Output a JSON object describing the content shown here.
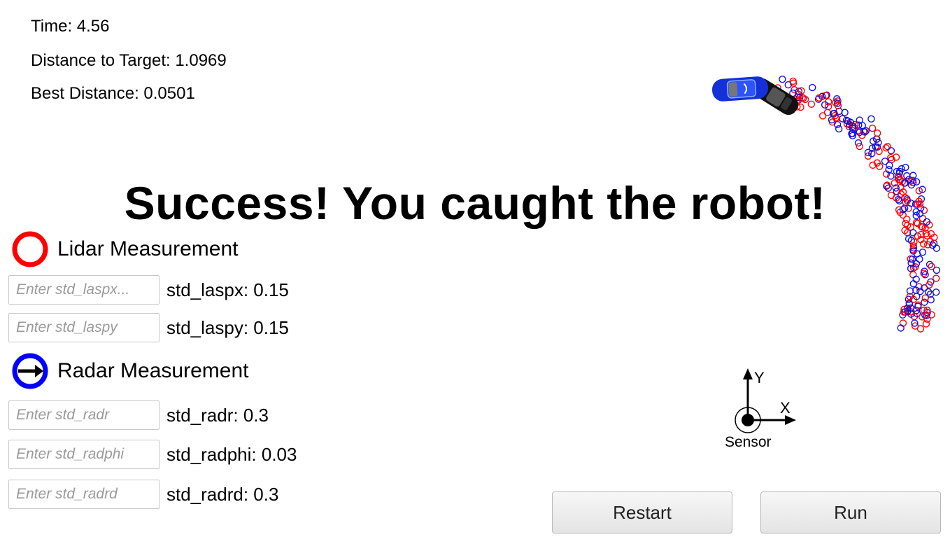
{
  "stats": {
    "time": "Time: 4.56",
    "distance": "Distance to Target: 1.0969",
    "best": "Best Distance: 0.0501"
  },
  "headline": "Success! You caught the robot!",
  "lidar": {
    "title": "Lidar Measurement",
    "color": "#ff0000",
    "fields": [
      {
        "placeholder": "Enter std_laspx...",
        "value_text": "std_laspx: 0.15"
      },
      {
        "placeholder": "Enter std_laspy",
        "value_text": "std_laspy: 0.15"
      }
    ]
  },
  "radar": {
    "title": "Radar Measurement",
    "color": "#0000ff",
    "fields": [
      {
        "placeholder": "Enter std_radr",
        "value_text": "std_radr: 0.3"
      },
      {
        "placeholder": "Enter std_radphi",
        "value_text": "std_radphi: 0.03"
      },
      {
        "placeholder": "Enter std_radrd",
        "value_text": "std_radrd: 0.3"
      }
    ]
  },
  "axes": {
    "y_label": "Y",
    "x_label": "X",
    "origin_label": "Sensor"
  },
  "buttons": {
    "restart": "Restart",
    "run": "Run"
  }
}
